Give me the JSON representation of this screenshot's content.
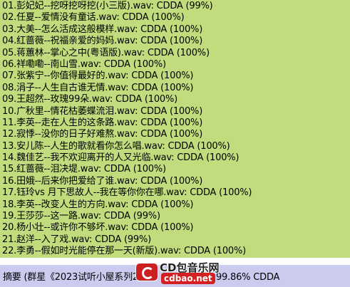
{
  "tracks": [
    "01.彭妃妃--挖呀挖呀挖(小三版).wav: CDDA (99%)",
    "02.任夏--爱情没有童话.wav: CDDA (100%)",
    "03.大美--怎么活成这般模样.wav: CDDA (100%)",
    "04.红蔷薇--祝福亲爱的妈妈.wav: CDDA (100%)",
    "05.蒋蕙林--掌心之中(粤语版).wav: CDDA (100%)",
    "06.祥嘞嘞--南山雪.wav: CDDA (100%)",
    "07.张紫宁--你值得最好的.wav: CDDA (100%)",
    "08.涓子--人生自古谁无情.wav: CDDA (100%)",
    "09.王超然--玫瑰99朵.wav: CDDA (100%)",
    "10.广秋里--情花枯萎蝶流泪.wav: CDDA (100%)",
    "11.李英--走在人生的这条路.wav: CDDA (100%)",
    "12.寂悸--没你的日子好难熬.wav: CDDA (100%)",
    "13.安儿陈--人生的歌就看你怎么唱.wav: CDDA (100%)",
    "14.魏佳艺--我不欢迎离开的人又光临.wav: CDDA (100%)",
    "15.红蔷薇--泪决堤.wav: CDDA (100%)",
    "16.田娥--后来你把爱给了谁.wav: CDDA (100%)",
    "17.钰玲vs 月下思故人--我在等你你在哪.wav: CDDA (100%)",
    "18.李英--改变人生的方向.wav: CDDA (100%)",
    "19.王莎莎--这一路.wav: CDDA (99%)",
    "20.杨小壮--或许你不够坏.wav: CDDA (100%)",
    "21.赵洋--入了戏.wav: CDDA (99%)",
    "22.李勇--假如时光能停在那一天(新版).wav: CDDA (100%)"
  ],
  "summary": {
    "text": "摘要 (群星《2023试听小屋系列2",
    "suffix": "): 99.86% CDDA"
  },
  "watermark": {
    "name": "CD包音乐网",
    "url": "cdbao.net"
  },
  "colors": {
    "list_background": "#c0dc7c",
    "summary_background": "#cbcbf0",
    "watermark_red": "#cc2020"
  }
}
